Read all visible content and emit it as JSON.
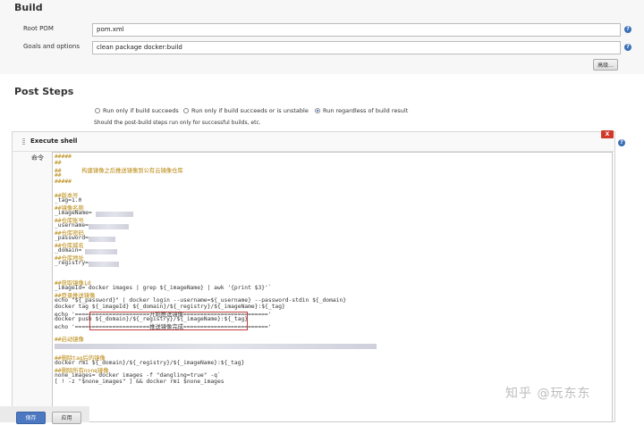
{
  "build": {
    "section_title": "Build",
    "root_pom_label": "Root POM",
    "root_pom_value": "pom.xml",
    "goals_label": "Goals and options",
    "goals_value": "clean package docker:build",
    "advanced_button": "高级..."
  },
  "post_steps": {
    "section_title": "Post Steps",
    "options": [
      {
        "label": "Run only if build succeeds",
        "selected": false
      },
      {
        "label": "Run only if build succeeds or is unstable",
        "selected": false
      },
      {
        "label": "Run regardless of build result",
        "selected": true
      }
    ],
    "hint": "Should the post-build steps run only for successful builds, etc."
  },
  "execute_shell": {
    "title": "Execute shell",
    "delete_label": "X",
    "command_label": "命令",
    "lines": [
      "#####",
      "##",
      "##      构建镜像之后推送镜像到公有云镜像仓库",
      "##",
      "#####",
      "",
      "##版本号",
      "_tag=1.0",
      "##镜像名称",
      "_imageName=",
      "##仓库账号",
      "_username=",
      "##仓库密码",
      "_password=",
      "##仓库域名",
      "_domain=",
      "##仓库地址",
      "_registry=",
      "",
      "",
      "##获取镜像id",
      "_imageId=`docker images | grep ${_imageName} | awk '{print $3}'`",
      "##登录推送镜像",
      "echo \"${_password}\" | docker login --username=${_username} --password-stdin ${_domain}",
      "docker tag ${_imageId} ${_domain}/${_registry}/${_imageName}:${_tag}",
      "echo '======================开始推送镜像========================='",
      "docker push ${_domain}/${_registry}/${_imageName}:${_tag}",
      "echo '======================推送镜像完成========================='",
      "",
      "##启动镜像",
      "",
      "",
      "##删除tag后的镜像",
      "docker rmi ${_domain}/${_registry}/${_imageName}:${_tag}",
      "##删除所有none镜像",
      "none_images=`docker images -f \"dangling=true\" -q`",
      "[ ! -z \"$none_images\" ] && docker rmi $none_images"
    ]
  },
  "footer": {
    "save_button": "保存",
    "apply_button": "应用"
  },
  "watermark": "知乎 @玩东东",
  "colors": {
    "save_button": "#4b78c1",
    "delete_button": "#d03a2b",
    "comment_text": "#b8860b",
    "help_icon": "#3b6fb6"
  }
}
